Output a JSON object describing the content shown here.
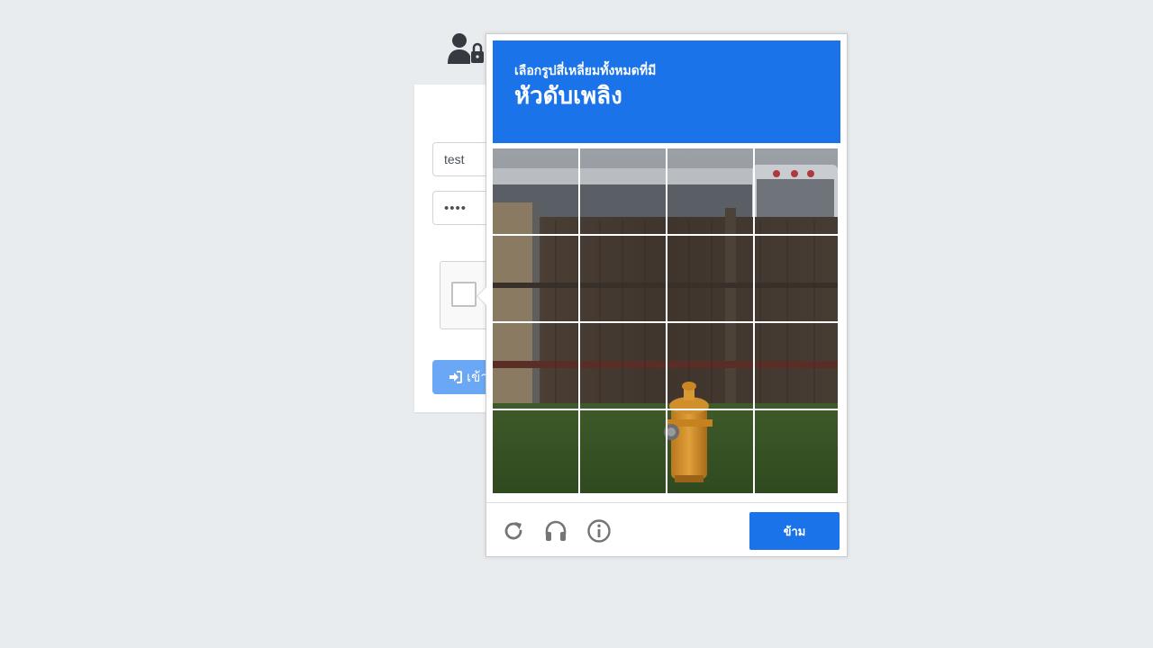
{
  "login": {
    "username_value": "test",
    "password_value": "••••",
    "login_button_label": "เข้า"
  },
  "captcha": {
    "instruction_line1": "เลือกรูปสี่เหลี่ยมทั้งหมดที่มี",
    "instruction_object": "หัวดับเพลิง",
    "skip_label": "ข้าม",
    "tile_count": 16,
    "icons": [
      "reload-icon",
      "headphones-icon",
      "info-icon"
    ],
    "colors": {
      "header_bg": "#1a73e8",
      "skip_bg": "#1a73e8",
      "login_btn_bg": "#6aa8f5",
      "page_bg": "#e9ecef"
    }
  }
}
